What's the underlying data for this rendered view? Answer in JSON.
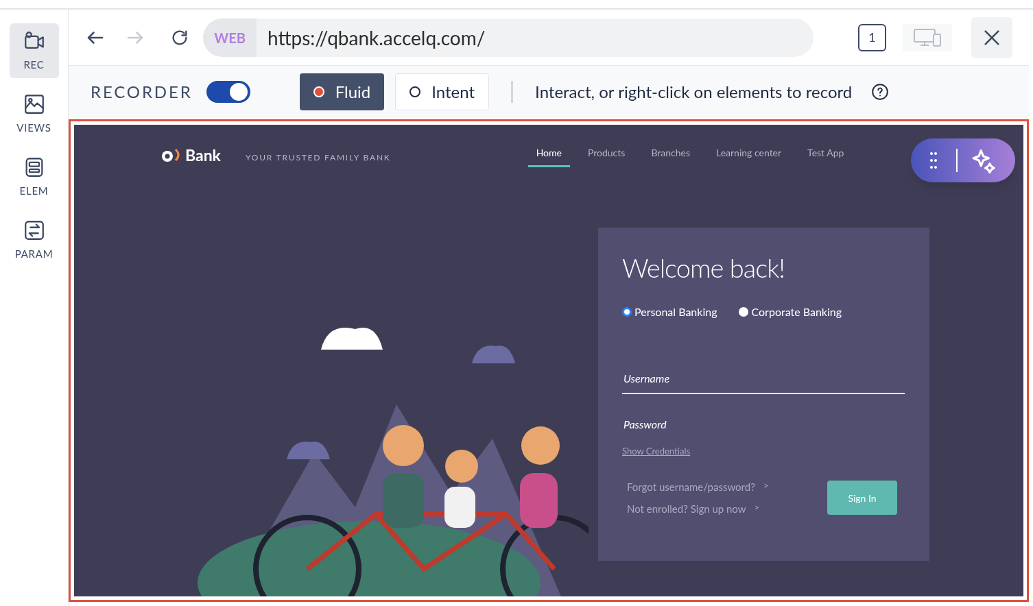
{
  "sidebar": {
    "items": [
      {
        "label": "REC",
        "selected": true
      },
      {
        "label": "VIEWS",
        "selected": false
      },
      {
        "label": "ELEM",
        "selected": false
      },
      {
        "label": "PARAM",
        "selected": false
      }
    ]
  },
  "toolbar": {
    "mode_badge": "WEB",
    "url": "https://qbank.accelq.com/",
    "tab_count": "1"
  },
  "recorder": {
    "label": "RECORDER",
    "on": true,
    "modes": [
      {
        "label": "Fluid",
        "selected": true
      },
      {
        "label": "Intent",
        "selected": false
      }
    ],
    "hint": "Interact, or right-click on elements to record"
  },
  "site": {
    "brand": "Bank",
    "tagline": "YOUR TRUSTED FAMILY BANK",
    "nav": [
      {
        "label": "Home",
        "selected": true
      },
      {
        "label": "Products",
        "selected": false
      },
      {
        "label": "Branches",
        "selected": false
      },
      {
        "label": "Learning center",
        "selected": false
      },
      {
        "label": "Test App",
        "selected": false
      }
    ],
    "login": {
      "title": "Welcome back!",
      "account_types": [
        {
          "label": "Personal Banking",
          "selected": true
        },
        {
          "label": "Corporate Banking",
          "selected": false
        }
      ],
      "username": {
        "placeholder": "Username"
      },
      "password": {
        "placeholder": "Password"
      },
      "show_credentials": "Show Credentials",
      "links": [
        {
          "label": "Forgot username/password?",
          "arrow": ">"
        },
        {
          "label": "Not enrolled? Sign up now",
          "arrow": ">"
        }
      ],
      "sign_in": "Sign In"
    }
  }
}
